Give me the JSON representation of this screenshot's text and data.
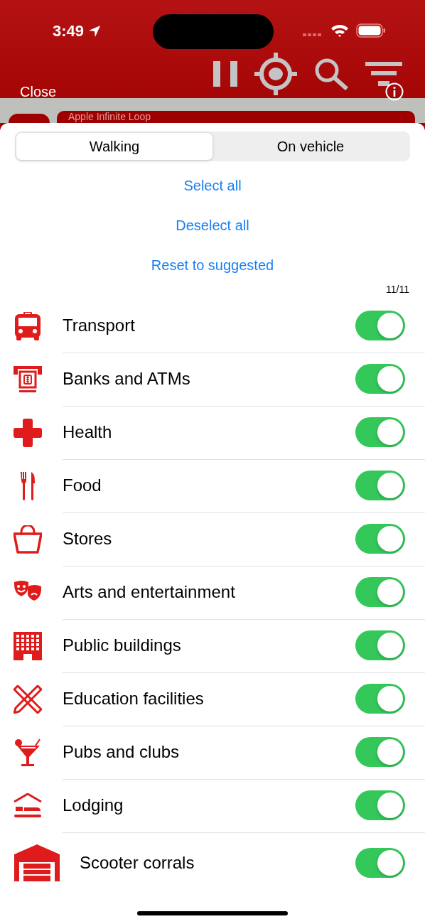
{
  "status_bar": {
    "time": "3:49"
  },
  "toolbar": {
    "close": "Close",
    "behind_field": "Apple Infinite Loop"
  },
  "tabs": [
    {
      "label": "Walking",
      "selected": true
    },
    {
      "label": "On vehicle",
      "selected": false
    }
  ],
  "actions": [
    "Select all",
    "Deselect all",
    "Reset to suggested"
  ],
  "count": "11/11",
  "categories": [
    {
      "label": "Transport",
      "on": true
    },
    {
      "label": "Banks and ATMs",
      "on": true
    },
    {
      "label": "Health",
      "on": true
    },
    {
      "label": "Food",
      "on": true
    },
    {
      "label": "Stores",
      "on": true
    },
    {
      "label": "Arts and entertainment",
      "on": true
    },
    {
      "label": "Public buildings",
      "on": true
    },
    {
      "label": "Education facilities",
      "on": true
    },
    {
      "label": "Pubs and clubs",
      "on": true
    },
    {
      "label": "Lodging",
      "on": true
    },
    {
      "label": "Scooter corrals",
      "on": true
    }
  ]
}
